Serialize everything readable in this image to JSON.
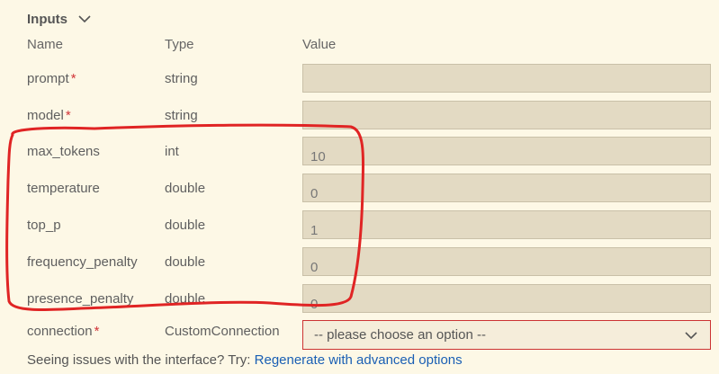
{
  "section": {
    "title": "Inputs"
  },
  "columns": {
    "name": "Name",
    "type": "Type",
    "value": "Value"
  },
  "rows": [
    {
      "name": "prompt",
      "required": "*",
      "type": "string",
      "value": ""
    },
    {
      "name": "model",
      "required": "*",
      "type": "string",
      "value": ""
    },
    {
      "name": "max_tokens",
      "required": "",
      "type": "int",
      "value": "10"
    },
    {
      "name": "temperature",
      "required": "",
      "type": "double",
      "value": "0"
    },
    {
      "name": "top_p",
      "required": "",
      "type": "double",
      "value": "1"
    },
    {
      "name": "frequency_penalty",
      "required": "",
      "type": "double",
      "value": "0"
    },
    {
      "name": "presence_penalty",
      "required": "",
      "type": "double",
      "value": "0"
    }
  ],
  "connection": {
    "name": "connection",
    "required": "*",
    "type": "CustomConnection",
    "selected": "-- please choose an option --"
  },
  "footer": {
    "text": "Seeing issues with the interface? Try: ",
    "link": "Regenerate with advanced options"
  },
  "colors": {
    "background": "#fdf8e6",
    "input_bg": "#e3dac3",
    "required": "#d13438",
    "link": "#1a5fb4",
    "annotation": "#e02424"
  }
}
